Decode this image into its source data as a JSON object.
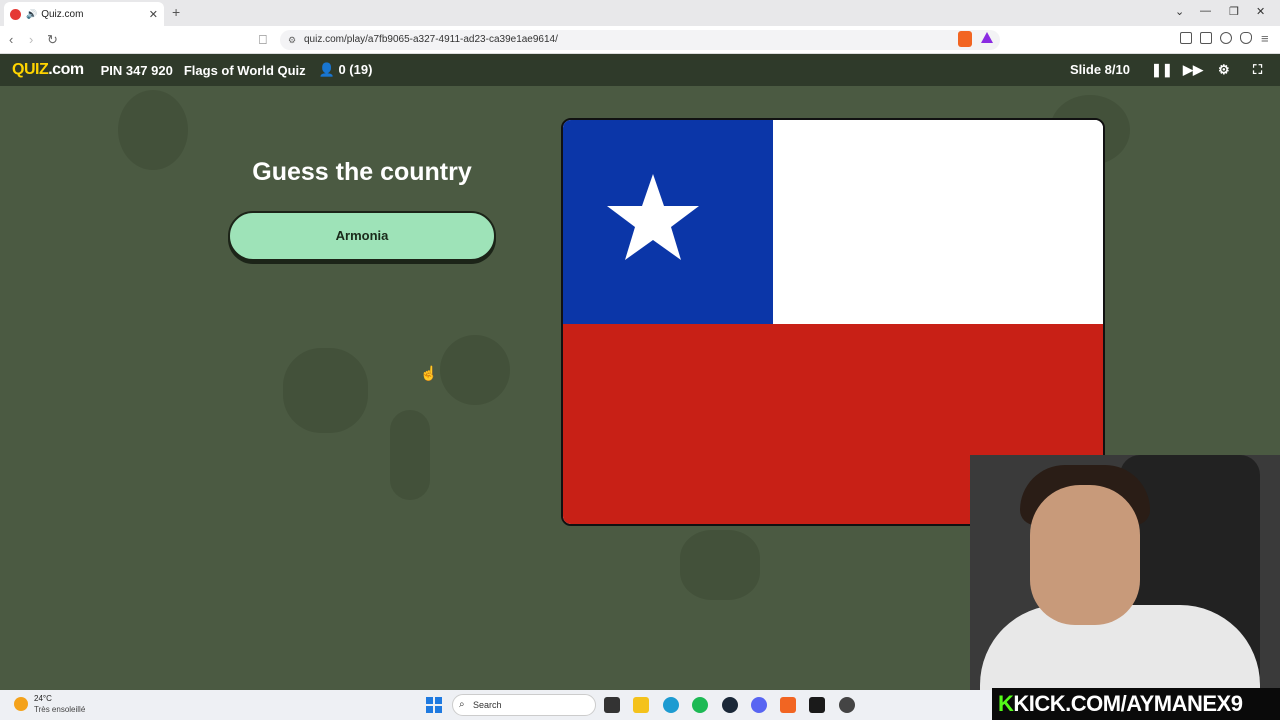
{
  "browser": {
    "tab_title": "Quiz.com",
    "url": "quiz.com/play/a7fb9065-a327-4911-ad23-ca39e1ae9614/"
  },
  "quiz_header": {
    "logo_main": "QUIZ",
    "logo_suffix": ".com",
    "pin": "PIN 347 920",
    "title": "Flags of World Quiz",
    "players": "0 (19)",
    "slide": "Slide 8/10"
  },
  "question": {
    "heading": "Guess the country",
    "answer": "Armonia"
  },
  "flag": {
    "colors": {
      "canton": "#0b36a8",
      "top": "#ffffff",
      "bottom": "#c82016",
      "star": "#ffffff"
    }
  },
  "taskbar": {
    "temperature": "24°C",
    "condition": "Très ensoleillé",
    "search_placeholder": "Search"
  },
  "overlay": {
    "kick_prefix": "K",
    "kick_text": "KICK.COM/AYMANEX9"
  }
}
